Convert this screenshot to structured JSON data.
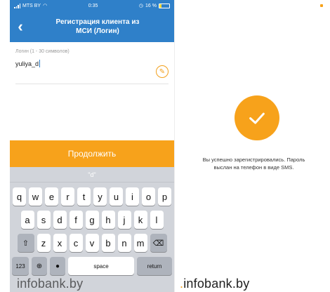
{
  "status_bar": {
    "carrier": "MTS BY",
    "time": "0:35",
    "battery": "16 %"
  },
  "nav": {
    "title_line1": "Регистрация клиента из",
    "title_line2": "МСИ (Логин)",
    "back_icon": "chevron-left-icon"
  },
  "form": {
    "label": "Логин (1 - 30 символов)",
    "value": "yuliya_d",
    "edit_icon": "pencil-icon"
  },
  "continue_label": "Продолжить",
  "keyboard": {
    "suggestion": "\"d\"",
    "row1": [
      "q",
      "w",
      "e",
      "r",
      "t",
      "y",
      "u",
      "i",
      "o",
      "p"
    ],
    "row2": [
      "a",
      "s",
      "d",
      "f",
      "g",
      "h",
      "j",
      "k",
      "l"
    ],
    "row3": [
      "z",
      "x",
      "c",
      "v",
      "b",
      "n",
      "m"
    ],
    "shift_icon": "shift-icon",
    "backspace_icon": "backspace-icon",
    "key_123": "123",
    "space_label": "space",
    "return_label": "return"
  },
  "success": {
    "icon": "checkmark-icon",
    "message_line1": "Вы успешно зарегистрировались. Пароль",
    "message_line2": "выслан на телефон в виде SMS."
  },
  "watermark": {
    "brand": "infobank",
    "tld": ".by"
  },
  "colors": {
    "primary_blue": "#2f80c9",
    "accent_orange": "#f7a21b"
  }
}
